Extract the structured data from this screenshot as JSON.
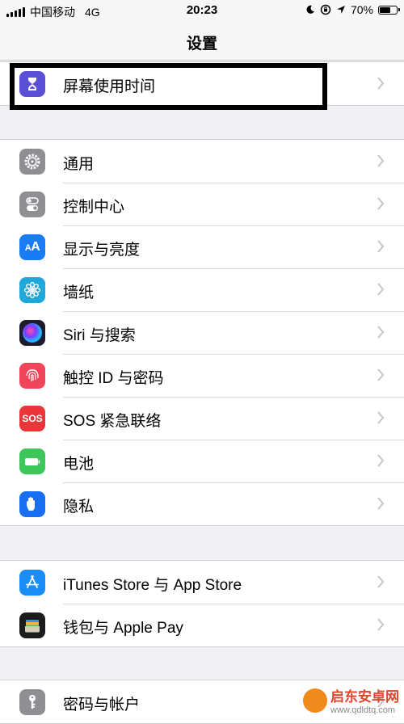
{
  "status_bar": {
    "carrier": "中国移动",
    "network": "4G",
    "time": "20:23",
    "battery": "70%",
    "battery_level": 0.7,
    "icons": [
      "signal-icon",
      "moon-icon",
      "lock-rotation-icon",
      "location-icon",
      "battery-icon"
    ]
  },
  "nav": {
    "title": "设置"
  },
  "groups": [
    {
      "items": [
        {
          "label": "屏幕使用时间",
          "icon": "hourglass-icon",
          "color": "#5b4fd6"
        }
      ]
    },
    {
      "items": [
        {
          "label": "通用",
          "icon": "gear-icon",
          "color": "#8e8e93"
        },
        {
          "label": "控制中心",
          "icon": "toggle-icon",
          "color": "#8e8e93"
        },
        {
          "label": "显示与亮度",
          "icon": "text-size-icon",
          "color": "#1a7cf5"
        },
        {
          "label": "墙纸",
          "icon": "flower-icon",
          "color": "#1fa8d9"
        },
        {
          "label": "Siri 与搜索",
          "icon": "siri-icon",
          "color": "#1c1c2e"
        },
        {
          "label": "触控 ID 与密码",
          "icon": "fingerprint-icon",
          "color": "#f0455a"
        },
        {
          "label": "SOS 紧急联络",
          "icon": "sos-icon",
          "color": "#e8363b",
          "icon_text": "SOS"
        },
        {
          "label": "电池",
          "icon": "battery-icon",
          "color": "#3dc65a"
        },
        {
          "label": "隐私",
          "icon": "hand-icon",
          "color": "#1a6ef0"
        }
      ]
    },
    {
      "items": [
        {
          "label": "iTunes Store 与 App Store",
          "icon": "app-store-icon",
          "color": "#1a8cf5"
        },
        {
          "label": "钱包与 Apple Pay",
          "icon": "wallet-icon",
          "color": "#1c1c1e"
        }
      ]
    },
    {
      "items": [
        {
          "label": "密码与帐户",
          "icon": "key-icon",
          "color": "#8e8e93"
        }
      ]
    }
  ],
  "watermark": {
    "text": "启东安卓网",
    "url": "www.qdldtq.com"
  }
}
